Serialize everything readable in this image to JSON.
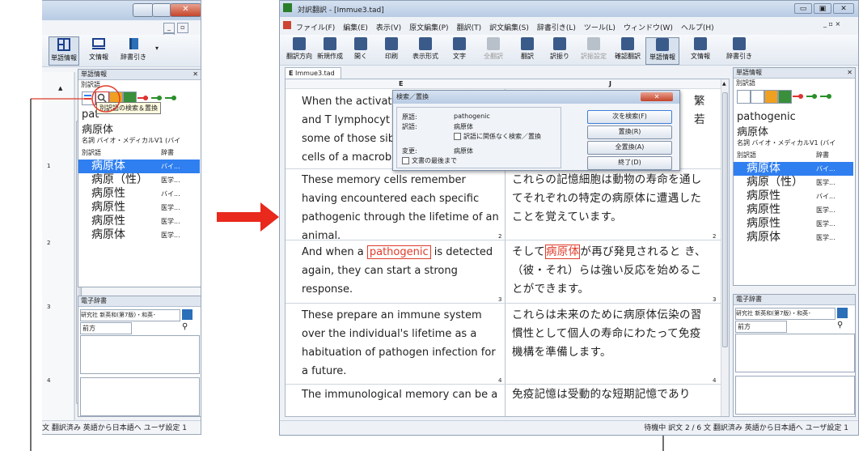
{
  "left_window": {
    "toolbar": {
      "word_info": "単語情報",
      "sentence_info": "文情報",
      "dict_lookup": "辞書引き"
    },
    "panel_title": "単語情報",
    "alt_label": "別訳語",
    "tooltip": "別訳語の検索＆置換",
    "source_word_partial": "pat",
    "target_word": "病原体",
    "pos_line": "名詞 バイオ・メディカルV1 (バイ",
    "col_alt": "別訳語",
    "col_dict": "辞書",
    "rows": [
      {
        "word": "病原体",
        "dict": "バイ..."
      },
      {
        "word": "病原（性）",
        "dict": "医学..."
      },
      {
        "word": "病原性",
        "dict": "バイ..."
      },
      {
        "word": "病原性",
        "dict": "医学..."
      },
      {
        "word": "病原性",
        "dict": "医学..."
      },
      {
        "word": "病原体",
        "dict": "医学..."
      }
    ],
    "edict_title": "電子辞書",
    "edict_select": "研究社 新英和(第7版)・和英･",
    "edict_dir": "前方",
    "status": "文 翻訳済み 英語から日本語へ ユーザ設定 1",
    "ruler_marks": [
      "1",
      "2",
      "3",
      "4"
    ]
  },
  "main_window": {
    "title": "対訳翻訳 - [Immue3.tad]",
    "menu": [
      "ファイル(F)",
      "編集(E)",
      "表示(V)",
      "原文編集(P)",
      "翻訳(T)",
      "訳文編集(S)",
      "辞書引き(L)",
      "ツール(L)",
      "ウィンドウ(W)",
      "ヘルプ(H)"
    ],
    "toolbar": [
      "翻訳方向",
      "新規作成",
      "開く",
      "印刷",
      "表示形式",
      "文字",
      "全翻訳",
      "翻訳",
      "訳振り",
      "訳振設定",
      "確認翻訳",
      "単語情報",
      "文情報",
      "辞書引き"
    ],
    "tab": "Immue3.tad",
    "col_en_header": "E",
    "col_jp_header": "J",
    "rows": [
      {
        "en": "When the activat",
        "en2": "and T lymphocyt",
        "en3": "some of those sib",
        "en4": "cells of a macrob",
        "jp": "繁",
        "jp2": "若",
        "num": ""
      },
      {
        "en": "These memory cells remember having encountered each specific pathogenic through the lifetime of an animal.",
        "jp": "これらの記憶細胞は動物の寿命を通してそれぞれの特定の病原体に遭遇したことを覚えています。",
        "num": "2"
      },
      {
        "en_pre": "And when a ",
        "en_hl": "pathogenic",
        "en_post": " is detected again, they can start a strong response.",
        "jp_pre": "そして",
        "jp_hl": "病原体",
        "jp_post": "が再び発見されると き、（彼・それ）らは強い反応を始めることができます。",
        "num": "3"
      },
      {
        "en": "These prepare an immune system over the individual's lifetime as a habituation of pathogen infection for a future.",
        "jp": "これらは未来のために病原体伝染の習慣性として個人の寿命にわたって免疫機構を準備します。",
        "num": "4"
      },
      {
        "en": "The immunological memory can be a",
        "jp": "免疫記憶は受動的な短期記憶であり",
        "num": ""
      }
    ],
    "dialog": {
      "title": "検索／置換",
      "src_label": "原語:",
      "src_value": "pathogenic",
      "tgt_label": "訳語:",
      "tgt_value": "病原体",
      "check_ignore": "訳語に関係なく検索／置換",
      "change_label": "変更:",
      "change_value": "病原体",
      "check_end": "文書の最後まで",
      "btn_next": "次を検索(F)",
      "btn_replace": "置換(R)",
      "btn_replace_all": "全置換(A)",
      "btn_close": "終了(D)"
    },
    "status": "待機中 訳文 2 / 6 文 翻訳済み 英語から日本語へ ユーザ設定 1",
    "edict_title": "電子辞書",
    "edict_select": "研究社 新英和(第7版)・和英･",
    "edict_dir": "前方",
    "side_panel_title": "単語情報",
    "side_alt_label": "別訳語",
    "side_source": "pathogenic",
    "side_target": "病原体",
    "side_pos": "名詞 バイオ・メディカルV1 (バイ",
    "side_col_alt": "別訳語",
    "side_col_dict": "辞書"
  },
  "colors": {
    "accent": "#e8291c",
    "selection": "#2f7ff0",
    "highlight": "#e03b2a"
  }
}
